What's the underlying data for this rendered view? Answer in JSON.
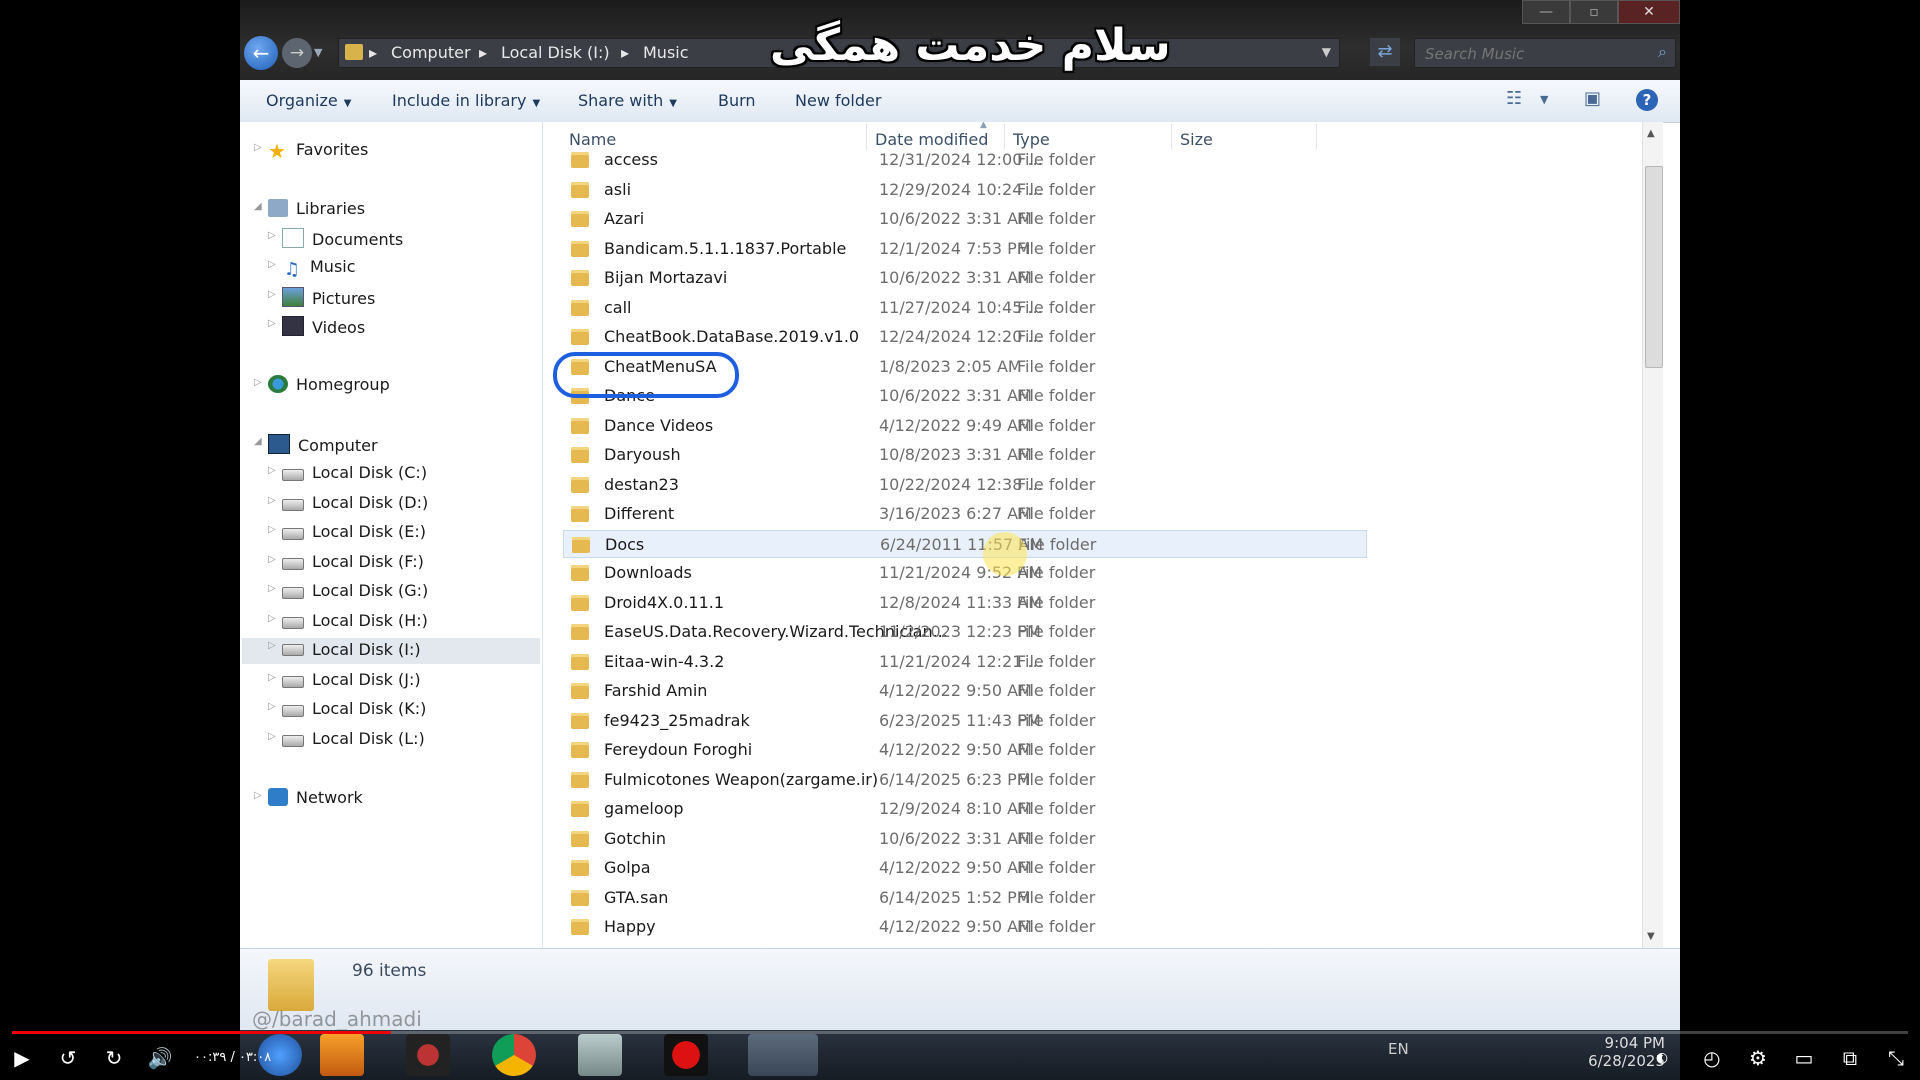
{
  "overlay_text": "سلام خدمت همگی",
  "window": {
    "address": [
      "Computer",
      "Local Disk (I:)",
      "Music"
    ],
    "search_placeholder": "Search Music",
    "buttons": {
      "minimize": "—",
      "maximize": "▫",
      "close": "✕"
    }
  },
  "toolbar": {
    "organize": "Organize",
    "include": "Include in library",
    "share": "Share with",
    "burn": "Burn",
    "new_folder": "New folder",
    "help": "?"
  },
  "nav": {
    "favorites": "Favorites",
    "libraries": "Libraries",
    "documents": "Documents",
    "music": "Music",
    "pictures": "Pictures",
    "videos": "Videos",
    "homegroup": "Homegroup",
    "computer": "Computer",
    "disks": [
      "Local Disk (C:)",
      "Local Disk (D:)",
      "Local Disk (E:)",
      "Local Disk (F:)",
      "Local Disk (G:)",
      "Local Disk (H:)",
      "Local Disk (I:)",
      "Local Disk (J:)",
      "Local Disk (K:)",
      "Local Disk (L:)"
    ],
    "network": "Network"
  },
  "columns": {
    "name": "Name",
    "date": "Date modified",
    "type": "Type",
    "size": "Size"
  },
  "files": [
    {
      "name": "access",
      "date": "12/31/2024 12:00 ...",
      "type": "File folder"
    },
    {
      "name": "asli",
      "date": "12/29/2024 10:24 ...",
      "type": "File folder"
    },
    {
      "name": "Azari",
      "date": "10/6/2022 3:31 AM",
      "type": "File folder"
    },
    {
      "name": "Bandicam.5.1.1.1837.Portable",
      "date": "12/1/2024 7:53 PM",
      "type": "File folder"
    },
    {
      "name": "Bijan Mortazavi",
      "date": "10/6/2022 3:31 AM",
      "type": "File folder"
    },
    {
      "name": "call",
      "date": "11/27/2024 10:45 ...",
      "type": "File folder"
    },
    {
      "name": "CheatBook.DataBase.2019.v1.0",
      "date": "12/24/2024 12:20 ...",
      "type": "File folder"
    },
    {
      "name": "CheatMenuSA",
      "date": "1/8/2023 2:05 AM",
      "type": "File folder"
    },
    {
      "name": "Dance",
      "date": "10/6/2022 3:31 AM",
      "type": "File folder"
    },
    {
      "name": "Dance Videos",
      "date": "4/12/2022 9:49 AM",
      "type": "File folder"
    },
    {
      "name": "Daryoush",
      "date": "10/8/2023 3:31 AM",
      "type": "File folder"
    },
    {
      "name": "destan23",
      "date": "10/22/2024 12:38 ...",
      "type": "File folder"
    },
    {
      "name": "Different",
      "date": "3/16/2023 6:27 AM",
      "type": "File folder"
    },
    {
      "name": "Docs",
      "date": "6/24/2011 11:57 AM",
      "type": "File folder"
    },
    {
      "name": "Downloads",
      "date": "11/21/2024 9:52 AM",
      "type": "File folder"
    },
    {
      "name": "Droid4X.0.11.1",
      "date": "12/8/2024 11:33 AM",
      "type": "File folder"
    },
    {
      "name": "EaseUS.Data.Recovery.Wizard.Technician...",
      "date": "11/2/2023 12:23 PM",
      "type": "File folder"
    },
    {
      "name": "Eitaa-win-4.3.2",
      "date": "11/21/2024 12:21 ...",
      "type": "File folder"
    },
    {
      "name": "Farshid Amin",
      "date": "4/12/2022 9:50 AM",
      "type": "File folder"
    },
    {
      "name": "fe9423_25madrak",
      "date": "6/23/2025 11:43 PM",
      "type": "File folder"
    },
    {
      "name": "Fereydoun Foroghi",
      "date": "4/12/2022 9:50 AM",
      "type": "File folder"
    },
    {
      "name": "Fulmicotones Weapon(zargame.ir)",
      "date": "6/14/2025 6:23 PM",
      "type": "File folder"
    },
    {
      "name": "gameloop",
      "date": "12/9/2024 8:10 AM",
      "type": "File folder"
    },
    {
      "name": "Gotchin",
      "date": "10/6/2022 3:31 AM",
      "type": "File folder"
    },
    {
      "name": "Golpa",
      "date": "4/12/2022 9:50 AM",
      "type": "File folder"
    },
    {
      "name": "GTA.san",
      "date": "6/14/2025 1:52 PM",
      "type": "File folder"
    },
    {
      "name": "Happy",
      "date": "4/12/2022 9:50 AM",
      "type": "File folder"
    }
  ],
  "status": {
    "count": "96 items",
    "watermark": "@/barad_ahmadi"
  },
  "taskbar": {
    "lang": "EN",
    "time": "9:04 PM",
    "date": "6/28/2025"
  },
  "player": {
    "time": "۰۰:۳۹ / ۰۳:۰۸",
    "progress_fraction": 0.2
  }
}
